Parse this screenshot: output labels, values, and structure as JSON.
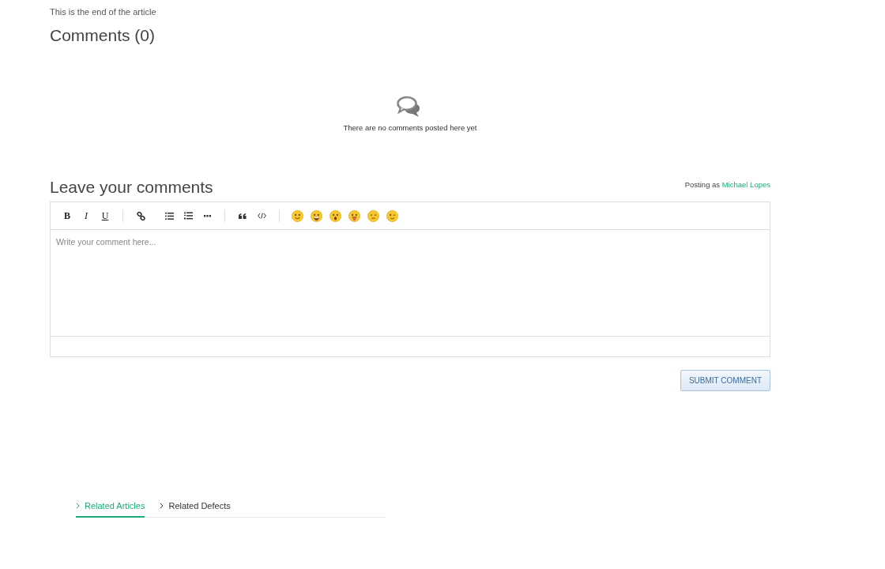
{
  "article_end": "This is the end of the article",
  "comments_heading": "Comments (0)",
  "empty_message": "There are no comments posted here yet",
  "leave_heading": "Leave your comments",
  "posting_as": {
    "label": "Posting as",
    "user": "Michael Lopes"
  },
  "editor": {
    "format_buttons": [
      "B",
      "I",
      "U"
    ],
    "placeholder": "Write your comment here..."
  },
  "submit_button": "SUBMIT COMMENT",
  "tabs": [
    {
      "label": "Related Articles",
      "selected": true
    },
    {
      "label": "Related Defects",
      "selected": false
    }
  ]
}
